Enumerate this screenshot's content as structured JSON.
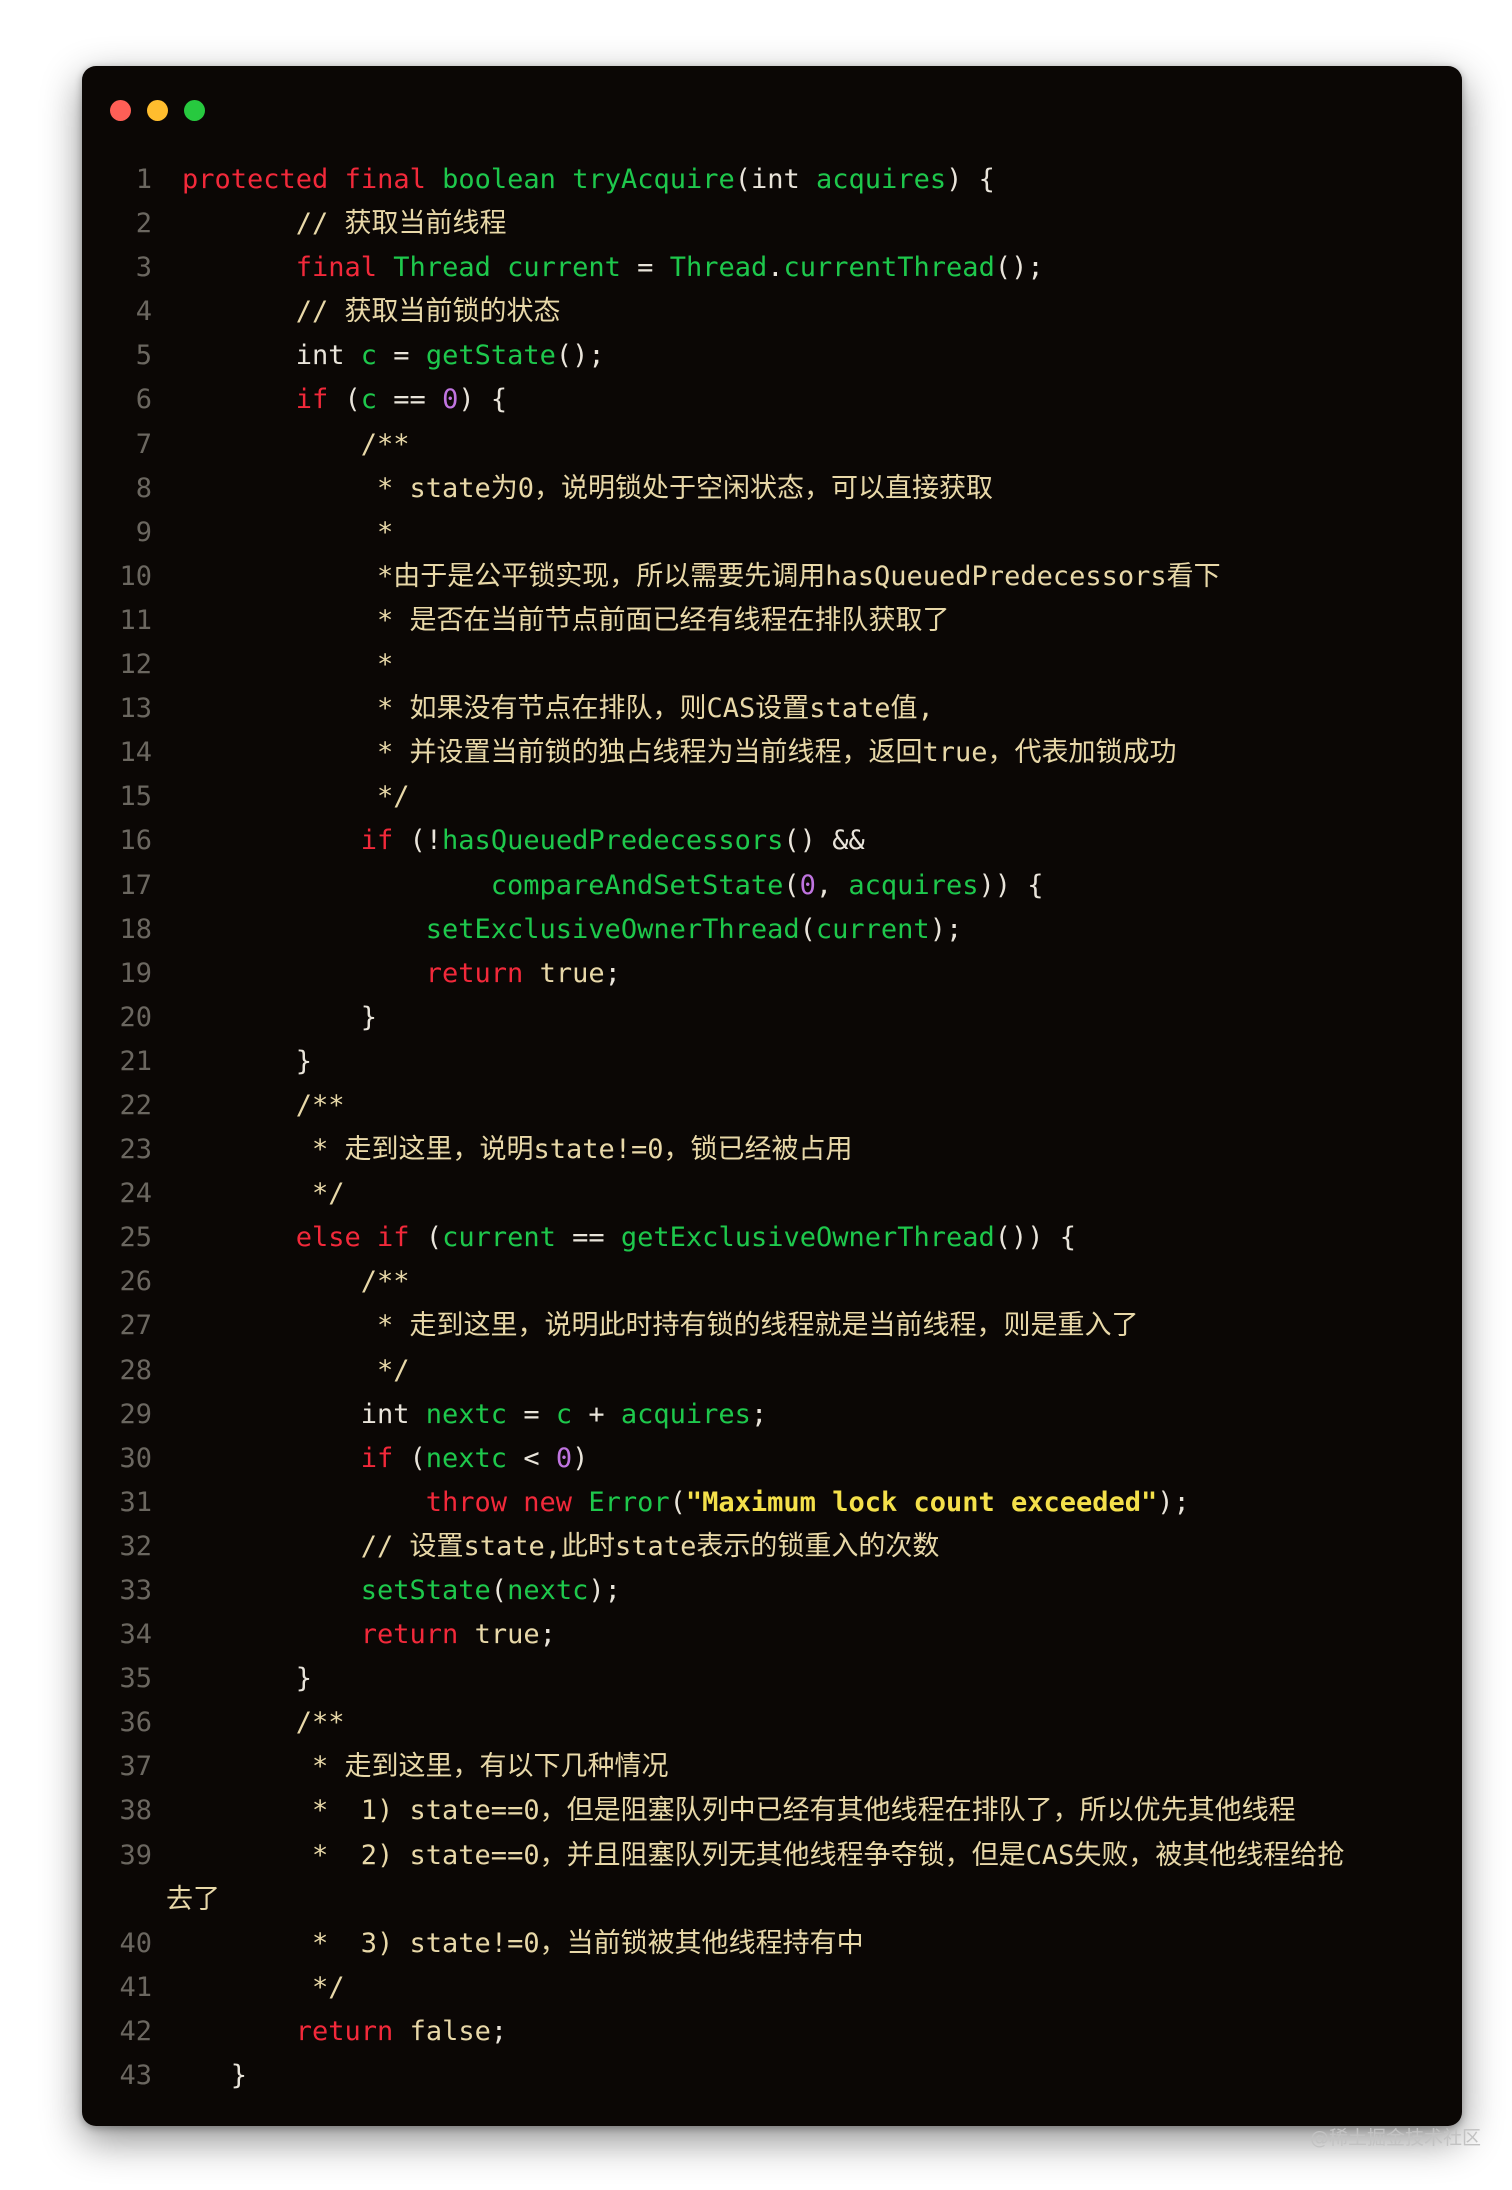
{
  "window": {
    "dots": [
      {
        "name": "close-dot",
        "color": "#ff5f56"
      },
      {
        "name": "minimize-dot",
        "color": "#ffbd2e"
      },
      {
        "name": "maximize-dot",
        "color": "#27c93f"
      }
    ]
  },
  "colors": {
    "keyword": "#f2293a",
    "type": "#1ec84c",
    "plain": "#e9e4da",
    "comment": "#e8d8a8",
    "number": "#c074e0",
    "string": "#f4e04a",
    "line_number": "#6b6760"
  },
  "lines": [
    {
      "n": "1",
      "i": 0,
      "t": [
        [
          "k",
          "protected"
        ],
        [
          "p",
          " "
        ],
        [
          "k",
          "final"
        ],
        [
          "p",
          " "
        ],
        [
          "y",
          "boolean"
        ],
        [
          "p",
          " "
        ],
        [
          "y",
          "tryAcquire"
        ],
        [
          "p",
          "(int "
        ],
        [
          "y",
          "acquires"
        ],
        [
          "p",
          ") {"
        ]
      ]
    },
    {
      "n": "2",
      "i": 7,
      "t": [
        [
          "c",
          "// 获取当前线程"
        ]
      ]
    },
    {
      "n": "3",
      "i": 7,
      "t": [
        [
          "k",
          "final"
        ],
        [
          "p",
          " "
        ],
        [
          "y",
          "Thread"
        ],
        [
          "p",
          " "
        ],
        [
          "y",
          "current"
        ],
        [
          "p",
          " = "
        ],
        [
          "y",
          "Thread"
        ],
        [
          "p",
          "."
        ],
        [
          "y",
          "currentThread"
        ],
        [
          "p",
          "();"
        ]
      ]
    },
    {
      "n": "4",
      "i": 7,
      "t": [
        [
          "c",
          "// 获取当前锁的状态"
        ]
      ]
    },
    {
      "n": "5",
      "i": 7,
      "t": [
        [
          "p",
          "int "
        ],
        [
          "y",
          "c"
        ],
        [
          "p",
          " = "
        ],
        [
          "y",
          "getState"
        ],
        [
          "p",
          "();"
        ]
      ]
    },
    {
      "n": "6",
      "i": 7,
      "t": [
        [
          "k",
          "if"
        ],
        [
          "p",
          " ("
        ],
        [
          "y",
          "c"
        ],
        [
          "p",
          " == "
        ],
        [
          "m",
          "0"
        ],
        [
          "p",
          ") {"
        ]
      ]
    },
    {
      "n": "7",
      "i": 11,
      "t": [
        [
          "c",
          "/**"
        ]
      ]
    },
    {
      "n": "8",
      "i": 12,
      "t": [
        [
          "c",
          "* state为0，说明锁处于空闲状态，可以直接获取"
        ]
      ]
    },
    {
      "n": "9",
      "i": 12,
      "t": [
        [
          "c",
          "*"
        ]
      ]
    },
    {
      "n": "10",
      "i": 12,
      "t": [
        [
          "c",
          "*由于是公平锁实现，所以需要先调用hasQueuedPredecessors看下"
        ]
      ]
    },
    {
      "n": "11",
      "i": 12,
      "t": [
        [
          "c",
          "* 是否在当前节点前面已经有线程在排队获取了"
        ]
      ]
    },
    {
      "n": "12",
      "i": 12,
      "t": [
        [
          "c",
          "*"
        ]
      ]
    },
    {
      "n": "13",
      "i": 12,
      "t": [
        [
          "c",
          "* 如果没有节点在排队，则CAS设置state值,"
        ]
      ]
    },
    {
      "n": "14",
      "i": 12,
      "t": [
        [
          "c",
          "* 并设置当前锁的独占线程为当前线程，返回true，代表加锁成功"
        ]
      ]
    },
    {
      "n": "15",
      "i": 12,
      "t": [
        [
          "c",
          "*/"
        ]
      ]
    },
    {
      "n": "16",
      "i": 11,
      "t": [
        [
          "k",
          "if"
        ],
        [
          "p",
          " (!"
        ],
        [
          "y",
          "hasQueuedPredecessors"
        ],
        [
          "p",
          "() &&"
        ]
      ]
    },
    {
      "n": "17",
      "i": 19,
      "t": [
        [
          "y",
          "compareAndSetState"
        ],
        [
          "p",
          "("
        ],
        [
          "m",
          "0"
        ],
        [
          "p",
          ", "
        ],
        [
          "y",
          "acquires"
        ],
        [
          "p",
          ")) {"
        ]
      ]
    },
    {
      "n": "18",
      "i": 15,
      "t": [
        [
          "y",
          "setExclusiveOwnerThread"
        ],
        [
          "p",
          "("
        ],
        [
          "y",
          "current"
        ],
        [
          "p",
          ");"
        ]
      ]
    },
    {
      "n": "19",
      "i": 15,
      "t": [
        [
          "k",
          "return"
        ],
        [
          "p",
          " "
        ],
        [
          "b",
          "true"
        ],
        [
          "p",
          ";"
        ]
      ]
    },
    {
      "n": "20",
      "i": 11,
      "t": [
        [
          "p",
          "}"
        ]
      ]
    },
    {
      "n": "21",
      "i": 7,
      "t": [
        [
          "p",
          "}"
        ]
      ]
    },
    {
      "n": "22",
      "i": 7,
      "t": [
        [
          "c",
          "/**"
        ]
      ]
    },
    {
      "n": "23",
      "i": 8,
      "t": [
        [
          "c",
          "* 走到这里，说明state!=0，锁已经被占用"
        ]
      ]
    },
    {
      "n": "24",
      "i": 8,
      "t": [
        [
          "c",
          "*/"
        ]
      ]
    },
    {
      "n": "25",
      "i": 7,
      "t": [
        [
          "k",
          "else"
        ],
        [
          "p",
          " "
        ],
        [
          "k",
          "if"
        ],
        [
          "p",
          " ("
        ],
        [
          "y",
          "current"
        ],
        [
          "p",
          " == "
        ],
        [
          "y",
          "getExclusiveOwnerThread"
        ],
        [
          "p",
          "()) {"
        ]
      ]
    },
    {
      "n": "26",
      "i": 11,
      "t": [
        [
          "c",
          "/**"
        ]
      ]
    },
    {
      "n": "27",
      "i": 12,
      "t": [
        [
          "c",
          "* 走到这里，说明此时持有锁的线程就是当前线程，则是重入了"
        ]
      ]
    },
    {
      "n": "28",
      "i": 12,
      "t": [
        [
          "c",
          "*/"
        ]
      ]
    },
    {
      "n": "29",
      "i": 11,
      "t": [
        [
          "p",
          "int "
        ],
        [
          "y",
          "nextc"
        ],
        [
          "p",
          " = "
        ],
        [
          "y",
          "c"
        ],
        [
          "p",
          " + "
        ],
        [
          "y",
          "acquires"
        ],
        [
          "p",
          ";"
        ]
      ]
    },
    {
      "n": "30",
      "i": 11,
      "t": [
        [
          "k",
          "if"
        ],
        [
          "p",
          " ("
        ],
        [
          "y",
          "nextc"
        ],
        [
          "p",
          " < "
        ],
        [
          "m",
          "0"
        ],
        [
          "p",
          ")"
        ]
      ]
    },
    {
      "n": "31",
      "i": 15,
      "t": [
        [
          "k",
          "throw"
        ],
        [
          "p",
          " "
        ],
        [
          "k",
          "new"
        ],
        [
          "p",
          " "
        ],
        [
          "y",
          "Error"
        ],
        [
          "p",
          "("
        ],
        [
          "s",
          "\"Maximum lock count exceeded\""
        ],
        [
          "p",
          ");"
        ]
      ]
    },
    {
      "n": "32",
      "i": 11,
      "t": [
        [
          "c",
          "// 设置state,此时state表示的锁重入的次数"
        ]
      ]
    },
    {
      "n": "33",
      "i": 11,
      "t": [
        [
          "y",
          "setState"
        ],
        [
          "p",
          "("
        ],
        [
          "y",
          "nextc"
        ],
        [
          "p",
          ");"
        ]
      ]
    },
    {
      "n": "34",
      "i": 11,
      "t": [
        [
          "k",
          "return"
        ],
        [
          "p",
          " "
        ],
        [
          "b",
          "true"
        ],
        [
          "p",
          ";"
        ]
      ]
    },
    {
      "n": "35",
      "i": 7,
      "t": [
        [
          "p",
          "}"
        ]
      ]
    },
    {
      "n": "36",
      "i": 7,
      "t": [
        [
          "c",
          "/**"
        ]
      ]
    },
    {
      "n": "37",
      "i": 8,
      "t": [
        [
          "c",
          "* 走到这里，有以下几种情况"
        ]
      ]
    },
    {
      "n": "38",
      "i": 8,
      "t": [
        [
          "c",
          "*  1) state==0，但是阻塞队列中已经有其他线程在排队了，所以优先其他线程"
        ]
      ]
    },
    {
      "n": "39",
      "i": 8,
      "t": [
        [
          "c",
          "*  2) state==0，并且阻塞队列无其他线程争夺锁，但是CAS失败，被其他线程给抢"
        ]
      ]
    },
    {
      "n": "",
      "i": 0,
      "wrap": true,
      "t": [
        [
          "c",
          "去了"
        ]
      ]
    },
    {
      "n": "40",
      "i": 8,
      "t": [
        [
          "c",
          "*  3) state!=0，当前锁被其他线程持有中"
        ]
      ]
    },
    {
      "n": "41",
      "i": 8,
      "t": [
        [
          "c",
          "*/"
        ]
      ]
    },
    {
      "n": "42",
      "i": 7,
      "t": [
        [
          "k",
          "return"
        ],
        [
          "p",
          " "
        ],
        [
          "b",
          "false"
        ],
        [
          "p",
          ";"
        ]
      ]
    },
    {
      "n": "43",
      "i": 3,
      "t": [
        [
          "p",
          "}"
        ]
      ]
    }
  ],
  "watermark": "@稀土掘金技术社区"
}
